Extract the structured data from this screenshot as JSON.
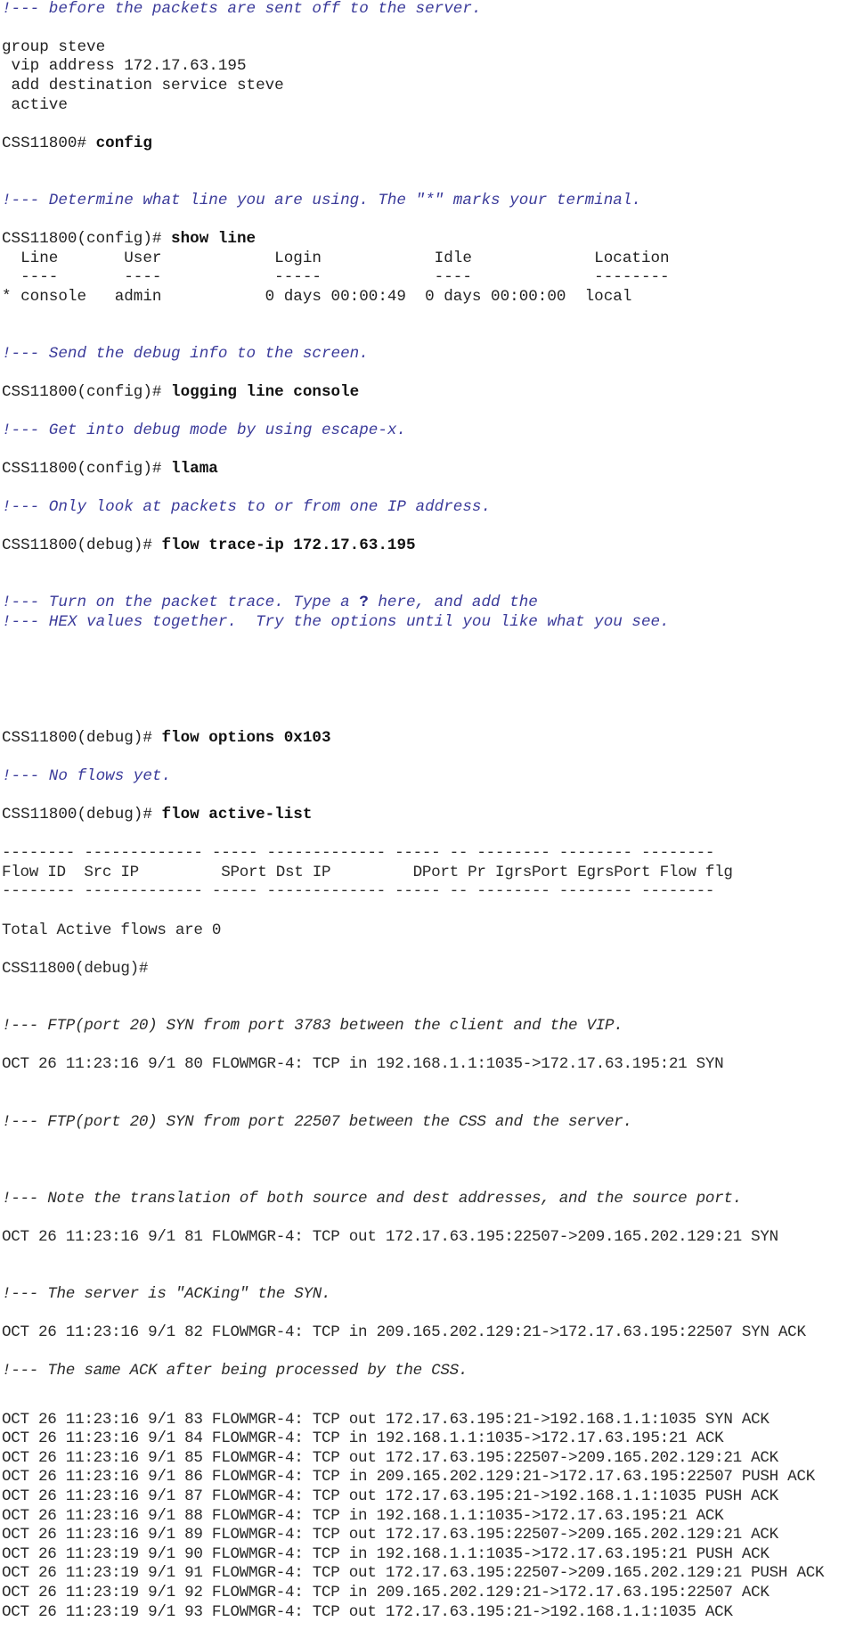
{
  "comments": {
    "c1": "!--- before the packets are sent off to the server.",
    "c2": "!--- Determine what line you are using. The \"*\" marks your terminal.",
    "c3": "!--- Send the debug info to the screen.",
    "c4": "!--- Get into debug mode by using escape-x.",
    "c5": "!--- Only look at packets to or from one IP address.",
    "c6a_pre": "!--- Turn on the packet trace. Type a ",
    "c6a_q": "?",
    "c6a_post": " here, and add the",
    "c6b": "!--- HEX values together.  Try the options until you like what you see.",
    "c7": "!--- No flows yet.",
    "c8": "!--- FTP(port 20) SYN from port 3783 between the client and the VIP.",
    "c9": "!--- FTP(port 20) SYN from port 22507 between the CSS and the server.",
    "c10": "!--- Note the translation of both source and dest addresses, and the source port.",
    "c11": "!--- The server is \"ACKing\" the SYN.",
    "c12": "!--- The same ACK after being processed by the CSS."
  },
  "config": {
    "group": "group steve",
    "vip": " vip address 172.17.63.195",
    "add_dest": " add destination service steve",
    "active": " active"
  },
  "prompts": {
    "root": "CSS11800# ",
    "config": "CSS11800(config)# ",
    "debug": "CSS11800(debug)# ",
    "debug_bare": "CSS11800(debug)#"
  },
  "commands": {
    "config": "config",
    "show_line": "show line",
    "logging": "logging line console",
    "llama": "llama",
    "trace_ip": "flow trace-ip 172.17.63.195",
    "flow_options": "flow options 0x103",
    "active_list": "flow active-list"
  },
  "show_line_table": {
    "header": "  Line       User            Login            Idle             Location",
    "dashes": "  ----       ----            -----            ----             --------",
    "rows": [
      "* console   admin           0 days 00:00:49  0 days 00:00:00  local"
    ]
  },
  "flow_table": {
    "dashes": "-------- ------------- ----- ------------- ----- -- -------- -------- --------",
    "header": "Flow ID  Src IP         SPort Dst IP         DPort Pr IgrsPort EgrsPort Flow flg",
    "total": "Total Active flows are 0"
  },
  "log_lines": [
    "OCT 26 11:23:16 9/1 80 FLOWMGR-4: TCP in 192.168.1.1:1035->172.17.63.195:21 SYN",
    "OCT 26 11:23:16 9/1 81 FLOWMGR-4: TCP out 172.17.63.195:22507->209.165.202.129:21 SYN",
    "OCT 26 11:23:16 9/1 82 FLOWMGR-4: TCP in 209.165.202.129:21->172.17.63.195:22507 SYN ACK",
    "OCT 26 11:23:16 9/1 83 FLOWMGR-4: TCP out 172.17.63.195:21->192.168.1.1:1035 SYN ACK",
    "OCT 26 11:23:16 9/1 84 FLOWMGR-4: TCP in 192.168.1.1:1035->172.17.63.195:21 ACK",
    "OCT 26 11:23:16 9/1 85 FLOWMGR-4: TCP out 172.17.63.195:22507->209.165.202.129:21 ACK",
    "OCT 26 11:23:16 9/1 86 FLOWMGR-4: TCP in 209.165.202.129:21->172.17.63.195:22507 PUSH ACK",
    "OCT 26 11:23:16 9/1 87 FLOWMGR-4: TCP out 172.17.63.195:21->192.168.1.1:1035 PUSH ACK",
    "OCT 26 11:23:16 9/1 88 FLOWMGR-4: TCP in 192.168.1.1:1035->172.17.63.195:21 ACK",
    "OCT 26 11:23:16 9/1 89 FLOWMGR-4: TCP out 172.17.63.195:22507->209.165.202.129:21 ACK",
    "OCT 26 11:23:19 9/1 90 FLOWMGR-4: TCP in 192.168.1.1:1035->172.17.63.195:21 PUSH ACK",
    "OCT 26 11:23:19 9/1 91 FLOWMGR-4: TCP out 172.17.63.195:22507->209.165.202.129:21 PUSH ACK",
    "OCT 26 11:23:19 9/1 92 FLOWMGR-4: TCP in 209.165.202.129:21->172.17.63.195:22507 ACK",
    "OCT 26 11:23:19 9/1 93 FLOWMGR-4: TCP out 172.17.63.195:21->192.168.1.1:1035 ACK"
  ]
}
